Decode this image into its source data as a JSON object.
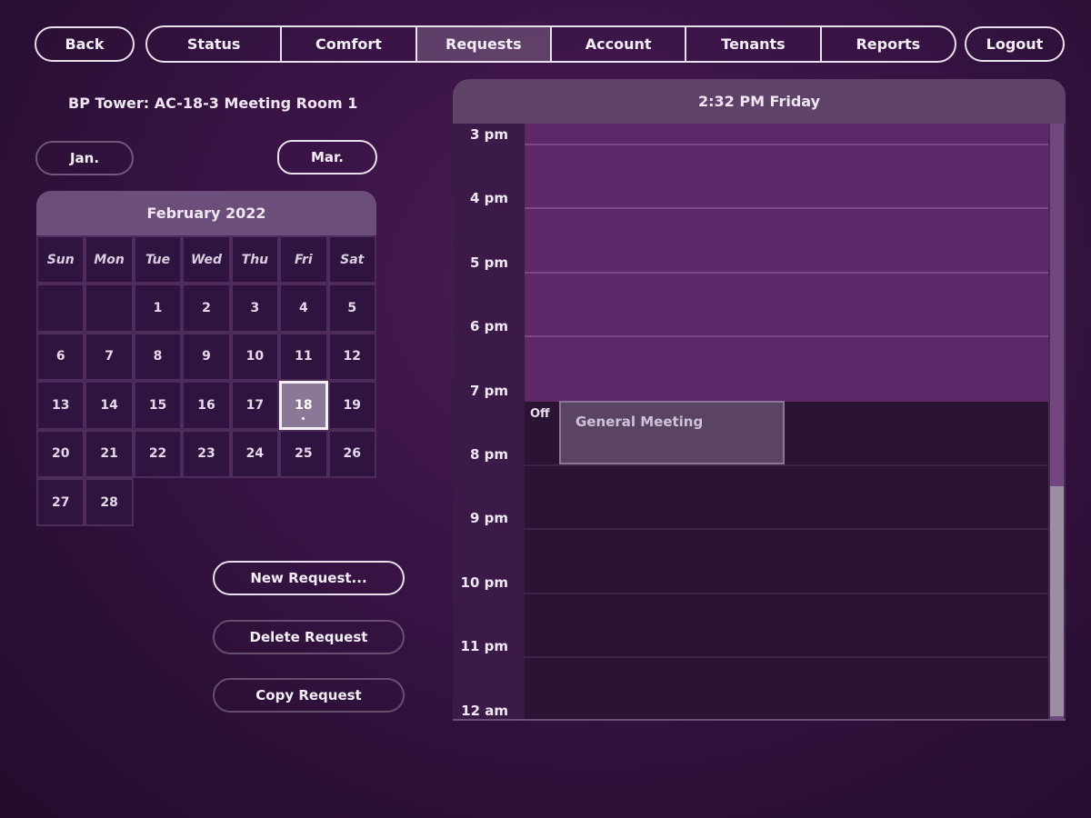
{
  "nav": {
    "back": "Back",
    "logout": "Logout",
    "tabs": [
      "Status",
      "Comfort",
      "Requests",
      "Account",
      "Tenants",
      "Reports"
    ],
    "active_tab": "Requests"
  },
  "room_title": "BP Tower: AC-18-3 Meeting Room 1",
  "month_nav": {
    "prev": "Jan.",
    "next": "Mar."
  },
  "calendar": {
    "title": "February 2022",
    "weekdays": [
      "Sun",
      "Mon",
      "Tue",
      "Wed",
      "Thu",
      "Fri",
      "Sat"
    ],
    "leading_blanks": 2,
    "days_in_month": 28,
    "selected_day": 18
  },
  "actions": {
    "new_request": "New Request...",
    "delete_request": "Delete Request",
    "copy_request": "Copy Request"
  },
  "schedule": {
    "header": "2:32 PM Friday",
    "hours": [
      "3 pm",
      "4 pm",
      "5 pm",
      "6 pm",
      "7 pm",
      "8 pm",
      "9 pm",
      "10 pm",
      "11 pm",
      "12 am"
    ],
    "off_label": "Off",
    "event": {
      "title": "General Meeting"
    }
  },
  "colors": {
    "accent_outline": "#e9e0ee",
    "unoccupied_block": "#5d2768",
    "occupied_block": "#2a1333",
    "event_fill": "#5a4363"
  }
}
